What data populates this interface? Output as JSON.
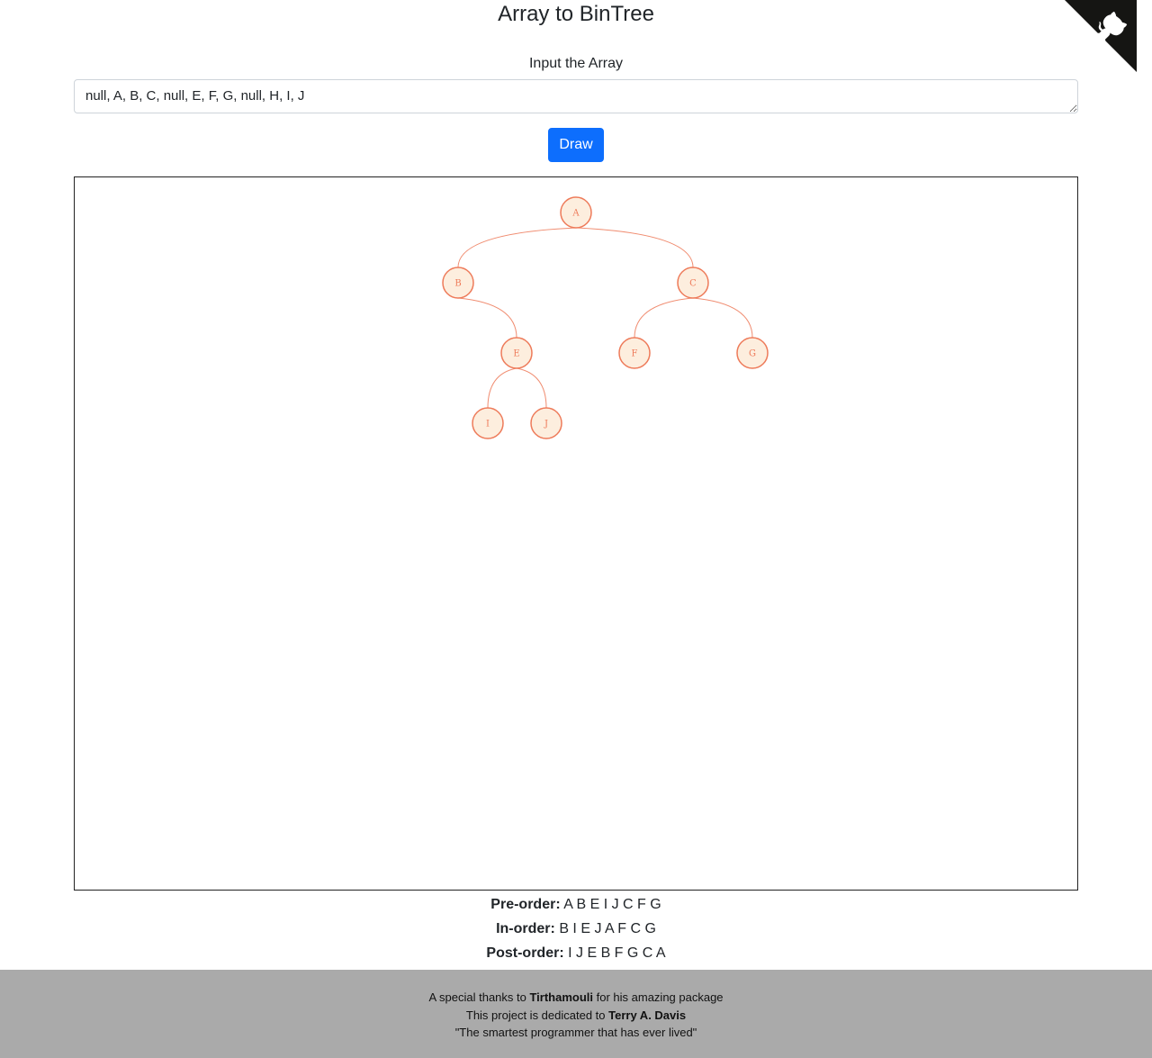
{
  "header": {
    "title": "Array to BinTree"
  },
  "corner": {
    "icon": "github-octocat-icon",
    "color": "#151513"
  },
  "form": {
    "label": "Input the Array",
    "array_value": "null, A, B, C, null, E, F, G, null, H, I, J",
    "draw_label": "Draw"
  },
  "tree": {
    "nodes": [
      {
        "id": "A",
        "label": "A",
        "parent": null
      },
      {
        "id": "B",
        "label": "B",
        "parent": "A"
      },
      {
        "id": "C",
        "label": "C",
        "parent": "A"
      },
      {
        "id": "E",
        "label": "E",
        "parent": "B"
      },
      {
        "id": "F",
        "label": "F",
        "parent": "C"
      },
      {
        "id": "G",
        "label": "G",
        "parent": "C"
      },
      {
        "id": "I",
        "label": "I",
        "parent": "E"
      },
      {
        "id": "J",
        "label": "J",
        "parent": "E"
      }
    ],
    "node_fill": "#fdeede",
    "node_stroke": "#ee7b5a",
    "link_color": "#f08c70"
  },
  "traversals": {
    "pre_label": "Pre-order:",
    "pre_value": "A B E I J C F G",
    "in_label": "In-order:",
    "in_value": "B I E J A F C G",
    "post_label": "Post-order:",
    "post_value": "I J E B F G C A"
  },
  "footer": {
    "line1_pre": "A special thanks to ",
    "line1_bold": "Tirthamouli",
    "line1_post": " for his amazing package",
    "line2_pre": "This project is dedicated to ",
    "line2_bold": "Terry A. Davis",
    "line3": "\"The smartest programmer that has ever lived\"",
    "background": "#aaaaaa"
  },
  "colors": {
    "accent": "#0d6efd"
  }
}
